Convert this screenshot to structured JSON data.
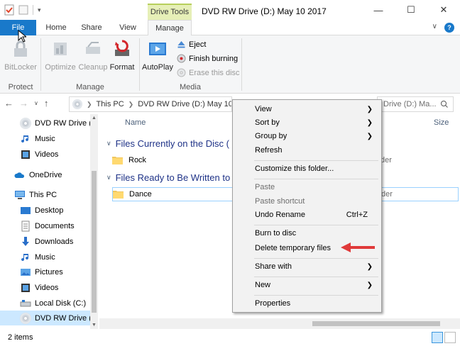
{
  "window": {
    "contextual_tab": "Drive Tools",
    "title": "DVD RW Drive (D:) May 10 2017"
  },
  "ribbon_tabs": {
    "file": "File",
    "home": "Home",
    "share": "Share",
    "view": "View",
    "manage": "Manage"
  },
  "ribbon": {
    "protect": {
      "bitlocker": "BitLocker",
      "label": "Protect"
    },
    "manage": {
      "optimize": "Optimize",
      "cleanup": "Cleanup",
      "format": "Format",
      "label": "Manage"
    },
    "media": {
      "autoplay": "AutoPlay",
      "eject": "Eject",
      "finish_burning": "Finish burning",
      "erase": "Erase this disc",
      "label": "Media"
    }
  },
  "address": {
    "crumb1": "This PC",
    "crumb2": "DVD RW Drive (D:) May 10 20",
    "search_tail": "Drive (D:) Ma..."
  },
  "columns": {
    "name": "Name",
    "size": "Size"
  },
  "nav_pane": {
    "items": [
      {
        "label": "DVD RW Drive (D:"
      },
      {
        "label": "Music"
      },
      {
        "label": "Videos"
      },
      {
        "label": "OneDrive"
      },
      {
        "label": "This PC"
      },
      {
        "label": "Desktop"
      },
      {
        "label": "Documents"
      },
      {
        "label": "Downloads"
      },
      {
        "label": "Music"
      },
      {
        "label": "Pictures"
      },
      {
        "label": "Videos"
      },
      {
        "label": "Local Disk (C:)"
      },
      {
        "label": "DVD RW Drive (D:"
      }
    ]
  },
  "groups": [
    {
      "title": "Files Currently on the Disc (",
      "files": [
        {
          "name": "Rock",
          "type": "der"
        }
      ]
    },
    {
      "title": "Files Ready to Be Written to",
      "files": [
        {
          "name": "Dance",
          "type": "der"
        }
      ]
    }
  ],
  "context_menu": {
    "view": "View",
    "sort_by": "Sort by",
    "group_by": "Group by",
    "refresh": "Refresh",
    "customize": "Customize this folder...",
    "paste": "Paste",
    "paste_shortcut": "Paste shortcut",
    "undo_rename": "Undo Rename",
    "undo_shortcut": "Ctrl+Z",
    "burn": "Burn to disc",
    "delete_temp": "Delete temporary files",
    "share_with": "Share with",
    "new": "New",
    "properties": "Properties"
  },
  "status": {
    "count": "2 items"
  },
  "colors": {
    "accent": "#1979ca",
    "contextual": "#e6efb7",
    "selection": "#cce8ff",
    "group_header": "#1e3287",
    "annotation_arrow": "#e03a3a"
  }
}
